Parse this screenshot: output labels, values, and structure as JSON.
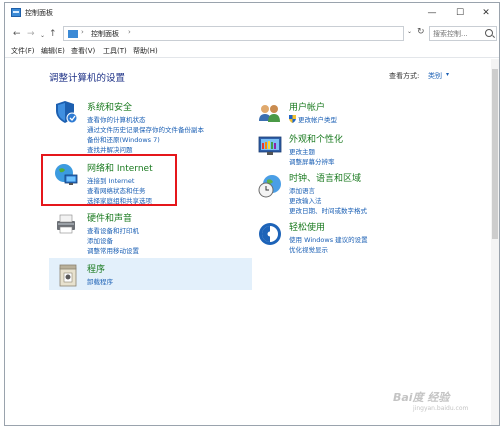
{
  "window": {
    "title": "控制面板",
    "controls": {
      "minimize": "—",
      "maximize": "☐",
      "close": "✕"
    }
  },
  "address": {
    "back": "←",
    "forward": "→",
    "dropdown": "⌄",
    "up": "↑",
    "separator": "›",
    "path": "控制面板",
    "refresh": "↻",
    "search_placeholder": "搜索控制..."
  },
  "menu": [
    "文件(F)",
    "编辑(E)",
    "查看(V)",
    "工具(T)",
    "帮助(H)"
  ],
  "content": {
    "heading": "调整计算机的设置",
    "view_label": "查看方式:",
    "view_value": "类别",
    "view_caret": "▾"
  },
  "categories": {
    "system": {
      "title": "系统和安全",
      "links": [
        "查看你的计算机状态",
        "通过文件历史记录保存你的文件备份副本",
        "备份和还原(Windows 7)",
        "查找并解决问题"
      ]
    },
    "network": {
      "title": "网络和 Internet",
      "links": [
        "连接到 Internet",
        "查看网络状态和任务",
        "选择家庭组和共享选项"
      ]
    },
    "hardware": {
      "title": "硬件和声音",
      "links": [
        "查看设备和打印机",
        "添加设备",
        "调整常用移动设置"
      ]
    },
    "programs": {
      "title": "程序",
      "links": [
        "卸载程序"
      ]
    },
    "user": {
      "title": "用户帐户",
      "links": [
        "更改帐户类型"
      ]
    },
    "appearance": {
      "title": "外观和个性化",
      "links": [
        "更改主题",
        "调整屏幕分辨率"
      ]
    },
    "clock": {
      "title": "时钟、语言和区域",
      "links": [
        "添加语言",
        "更改输入法",
        "更改日期、时间或数字格式"
      ]
    },
    "ease": {
      "title": "轻松使用",
      "links": [
        "使用 Windows 建议的设置",
        "优化视觉显示"
      ]
    }
  },
  "watermark": {
    "main": "Bai度 经验",
    "sub": "jingyan.baidu.com"
  },
  "colors": {
    "category_title": "#1a7a1f",
    "link": "#1a5fb4",
    "heading": "#1e3287",
    "highlight": "#e5161b"
  }
}
